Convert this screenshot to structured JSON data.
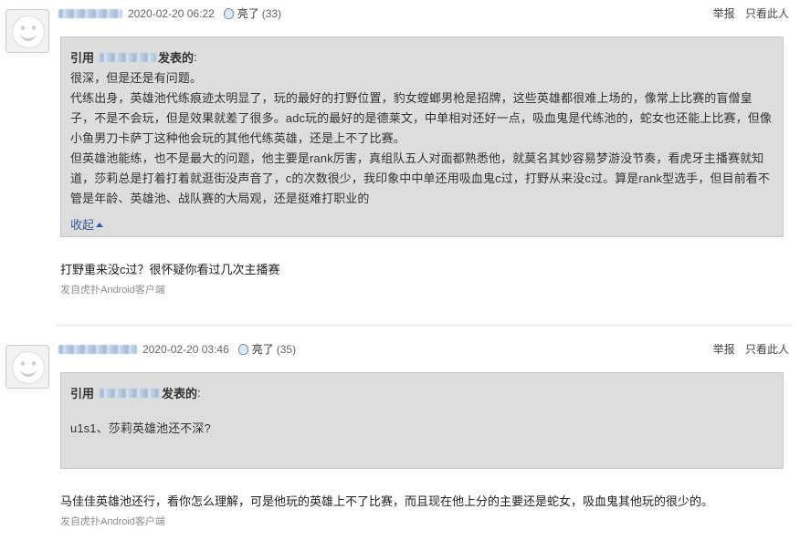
{
  "posts": [
    {
      "time": "2020-02-20 06:22",
      "light_label": "亮了",
      "light_count": "(33)",
      "actions": [
        "举报",
        "只看此人"
      ],
      "quote": {
        "prefix": "引用",
        "suffix": "发表的",
        "colon": ":",
        "paragraphs": [
          "很深，但是还是有问题。",
          "代练出身，英雄池代练痕迹太明显了，玩的最好的打野位置，豹女螳螂男枪是招牌，这些英雄都很难上场的，像常上比赛的盲僧皇子，不是不会玩，但是效果就差了很多。adc玩的最好的是德莱文，中单相对还好一点，吸血鬼是代练池的，蛇女也还能上比赛，但像小鱼男刀卡萨丁这种他会玩的其他代练英雄，还是上不了比赛。",
          "但英雄池能练，也不是最大的问题，他主要是rank厉害，真组队五人对面都熟悉他，就莫名其妙容易梦游没节奏，看虎牙主播赛就知道，莎莉总是打着打着就逛街没声音了，c的次数很少，我印象中中单还用吸血鬼c过，打野从来没c过。算是rank型选手，但目前看不管是年龄、英雄池、战队赛的大局观，还是挺难打职业的"
        ],
        "collapse_label": "收起"
      },
      "reply": "打野重来没c过？很怀疑你看过几次主播赛",
      "source": "发自虎扑Android客户端"
    },
    {
      "time": "2020-02-20 03:46",
      "light_label": "亮了",
      "light_count": "(35)",
      "actions": [
        "举报",
        "只看此人"
      ],
      "quote": {
        "prefix": "引用",
        "suffix": "发表的",
        "colon": ":",
        "paragraphs": [
          "u1s1、莎莉英雄池还不深?"
        ]
      },
      "reply": "马佳佳英雄池还行，看你怎么理解，可是他玩的英雄上不了比赛，而且现在他上分的主要还是蛇女，吸血鬼其他玩的很少的。",
      "source": "发自虎扑Android客户端"
    }
  ]
}
